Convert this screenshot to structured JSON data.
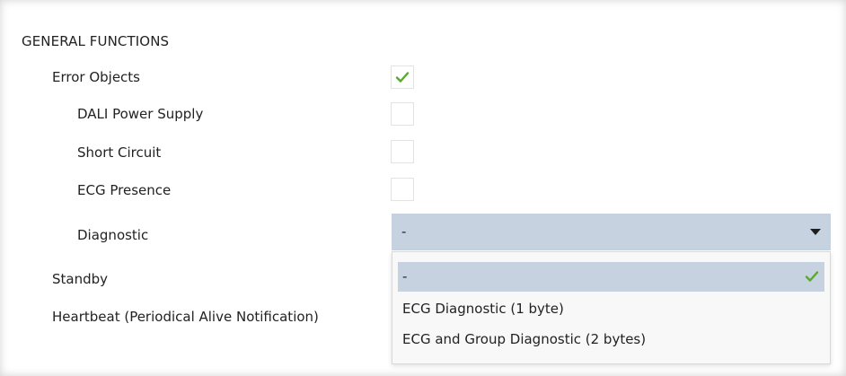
{
  "section": {
    "title": "GENERAL FUNCTIONS"
  },
  "rows": {
    "error_objects": {
      "label": "Error Objects",
      "checked": true
    },
    "dali_power_supply": {
      "label": "DALI Power Supply",
      "checked": false
    },
    "short_circuit": {
      "label": "Short Circuit",
      "checked": false
    },
    "ecg_presence": {
      "label": "ECG Presence",
      "checked": false
    },
    "diagnostic": {
      "label": "Diagnostic"
    },
    "standby": {
      "label": "Standby"
    },
    "heartbeat": {
      "label": "Heartbeat (Periodical Alive Notification)"
    }
  },
  "diagnostic_select": {
    "value": "-",
    "options": [
      {
        "label": "-",
        "selected": true
      },
      {
        "label": "ECG Diagnostic (1 byte)",
        "selected": false
      },
      {
        "label": "ECG and Group Diagnostic (2 bytes)",
        "selected": false
      }
    ]
  },
  "colors": {
    "check_green": "#5aa832",
    "select_bg": "#c6d2df",
    "dropdown_bg": "#f8f8f8"
  },
  "icons": {
    "checkmark": "check-icon",
    "dropdown_arrow": "chevron-down-icon"
  }
}
